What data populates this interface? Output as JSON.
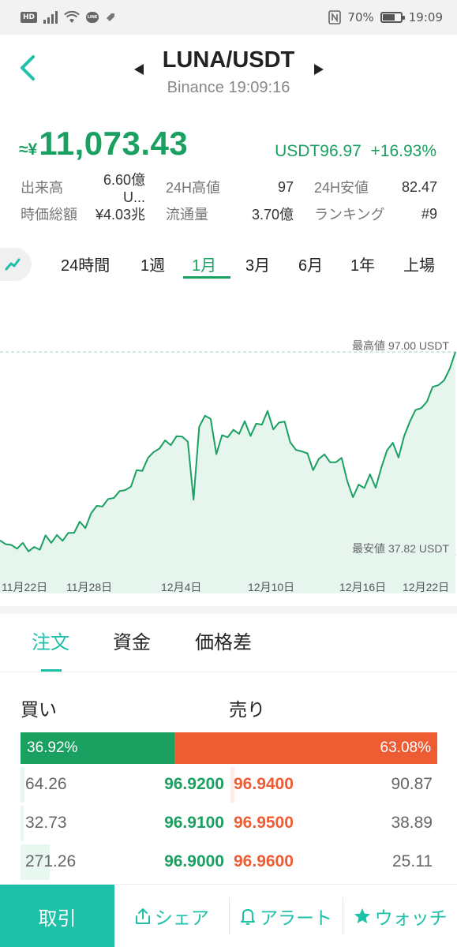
{
  "status_bar": {
    "hd": "HD",
    "line": "LINE",
    "battery": "70%",
    "time": "19:09",
    "icons": [
      "hd-badge",
      "signal-icon",
      "wifi-icon",
      "line-app-icon",
      "tag-icon",
      "nfc-icon",
      "battery-icon"
    ]
  },
  "header": {
    "title": "LUNA/USDT",
    "subtitle": "Binance 19:09:16"
  },
  "price": {
    "prefix": "≈¥",
    "value": "11,073.43",
    "quote": "USDT",
    "last": "96.97",
    "change": "+16.93%"
  },
  "stats": [
    [
      {
        "label": "出来高",
        "value": "6.60億 U..."
      },
      {
        "label": "24H高値",
        "value": "97"
      },
      {
        "label": "24H安値",
        "value": "82.47"
      }
    ],
    [
      {
        "label": "時価総額",
        "value": "¥4.03兆"
      },
      {
        "label": "流通量",
        "value": "3.70億"
      },
      {
        "label": "ランキング",
        "value": "#9"
      }
    ]
  ],
  "periods": [
    "24時間",
    "1週",
    "1月",
    "3月",
    "6月",
    "1年",
    "上場"
  ],
  "active_period": "1月",
  "chart_data": {
    "type": "area",
    "x_ticks": [
      "11月22日",
      "11月28日",
      "12月4日",
      "12月10日",
      "12月16日",
      "12月22日"
    ],
    "high_label": "最高値 97.00 USDT",
    "low_label": "最安値 37.82 USDT",
    "ylim": [
      37.82,
      97.0
    ],
    "series": [
      {
        "values": [
          42.0,
          40.9,
          40.7,
          39.6,
          41.3,
          38.8,
          40.1,
          39.3,
          43.5,
          41.3,
          43.6,
          41.9,
          44.2,
          44.2,
          47.5,
          45.6,
          49.9,
          52.1,
          51.9,
          54.1,
          54.4,
          56.4,
          56.7,
          57.7,
          62.5,
          62.3,
          66.1,
          67.8,
          68.8,
          71.2,
          69.8,
          72.4,
          72.3,
          70.8,
          53.9,
          75.2,
          78.4,
          77.5,
          67.2,
          72.7,
          72.1,
          74.3,
          73.1,
          76.8,
          72.5,
          76.1,
          75.8,
          79.8,
          74.4,
          76.4,
          76.7,
          70.6,
          68.4,
          68.0,
          67.4,
          62.5,
          65.8,
          67.1,
          64.8,
          64.8,
          66.1,
          59.3,
          54.6,
          58.3,
          57.3,
          61.3,
          57.4,
          63.3,
          68.3,
          70.5,
          66.2,
          72.5,
          76.7,
          80.1,
          80.6,
          82.5,
          86.8,
          87.3,
          88.7,
          92.1,
          97.0
        ]
      }
    ],
    "line_color": "#1aa061",
    "fill_color": "#e6f6ee",
    "grid": false
  },
  "order_tabs": [
    "注文",
    "資金",
    "価格差"
  ],
  "active_order_tab": "注文",
  "order_book": {
    "buy_label": "買い",
    "sell_label": "売り",
    "buy_ratio": "36.92%",
    "sell_ratio": "63.08%",
    "buy_ratio_value": 36.92,
    "rows": [
      {
        "buy_qty": "64.26",
        "buy_price": "96.9200",
        "sell_price": "96.9400",
        "sell_qty": "90.87",
        "buy_depth": 0.02,
        "sell_depth": 0.02
      },
      {
        "buy_qty": "32.73",
        "buy_price": "96.9100",
        "sell_price": "96.9500",
        "sell_qty": "38.89",
        "buy_depth": 0.015,
        "sell_depth": 0.0
      },
      {
        "buy_qty": "271.26",
        "buy_price": "96.9000",
        "sell_price": "96.9600",
        "sell_qty": "25.11",
        "buy_depth": 0.14,
        "sell_depth": 0.0
      }
    ]
  },
  "colors": {
    "green": "#1aa061",
    "teal": "#1ec1a8",
    "red": "#ee5c33"
  },
  "bottom_bar": {
    "trade": "取引",
    "share": "シェア",
    "alert": "アラート",
    "watch": "ウォッチ"
  }
}
